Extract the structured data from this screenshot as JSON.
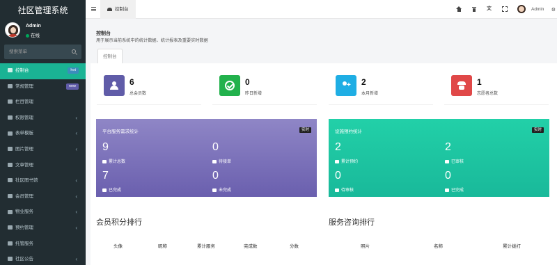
{
  "app": {
    "title": "社区管理系统"
  },
  "user": {
    "name": "Admin",
    "status": "在线"
  },
  "search": {
    "placeholder": "搜索菜单"
  },
  "sidebar": {
    "items": [
      {
        "label": "控制台",
        "badge": "hot",
        "active": true
      },
      {
        "label": "常规管理",
        "badge": "new"
      },
      {
        "label": "栏目管理"
      },
      {
        "label": "权限管理",
        "arrow": "‹"
      },
      {
        "label": "表单模板",
        "arrow": "‹"
      },
      {
        "label": "图片管理",
        "arrow": "‹"
      },
      {
        "label": "文章管理"
      },
      {
        "label": "社区图书馆",
        "arrow": "‹"
      },
      {
        "label": "会员管理",
        "arrow": "‹"
      },
      {
        "label": "物业服务",
        "arrow": "‹"
      },
      {
        "label": "预约管理",
        "arrow": "‹"
      },
      {
        "label": "托管服务"
      },
      {
        "label": "社区公告",
        "arrow": "‹"
      }
    ]
  },
  "topbar": {
    "tab": "控制台",
    "user_name": "Admin",
    "lang_glyph": "文"
  },
  "page": {
    "title": "控制台",
    "subtitle": "用于展示当前系统中的统计数据、统计报表及重要实时数据",
    "tab": "控制台"
  },
  "stats": [
    {
      "value": "6",
      "label": "总会员数",
      "color": "#605ca8",
      "icon": "users-icon"
    },
    {
      "value": "0",
      "label": "昨日新增",
      "color": "#22b14c",
      "icon": "check-icon"
    },
    {
      "value": "2",
      "label": "本月新增",
      "color": "#1faee4",
      "icon": "add-user-icon"
    },
    {
      "value": "1",
      "label": "志愿者总数",
      "color": "#e04848",
      "icon": "volunteer-icon"
    }
  ],
  "service_card": {
    "title": "平台服务需求统计",
    "tag": "实时",
    "metrics": [
      {
        "value": "9",
        "label": "累计总数"
      },
      {
        "value": "0",
        "label": "待接单"
      },
      {
        "value": "7",
        "label": "已完成"
      },
      {
        "value": "0",
        "label": "未完成"
      }
    ]
  },
  "booking_card": {
    "title": "设施预约统计",
    "tag": "实时",
    "metrics": [
      {
        "value": "2",
        "label": "累计预约"
      },
      {
        "value": "2",
        "label": "已审核"
      },
      {
        "value": "0",
        "label": "待审核"
      },
      {
        "value": "0",
        "label": "已完成"
      }
    ]
  },
  "ranking": {
    "title": "会员积分排行",
    "columns": [
      "头像",
      "昵称",
      "累计服务",
      "完成数",
      "分数"
    ]
  },
  "consult": {
    "title": "服务咨询排行",
    "columns": [
      "照片",
      "名称",
      "累计拨打"
    ]
  }
}
